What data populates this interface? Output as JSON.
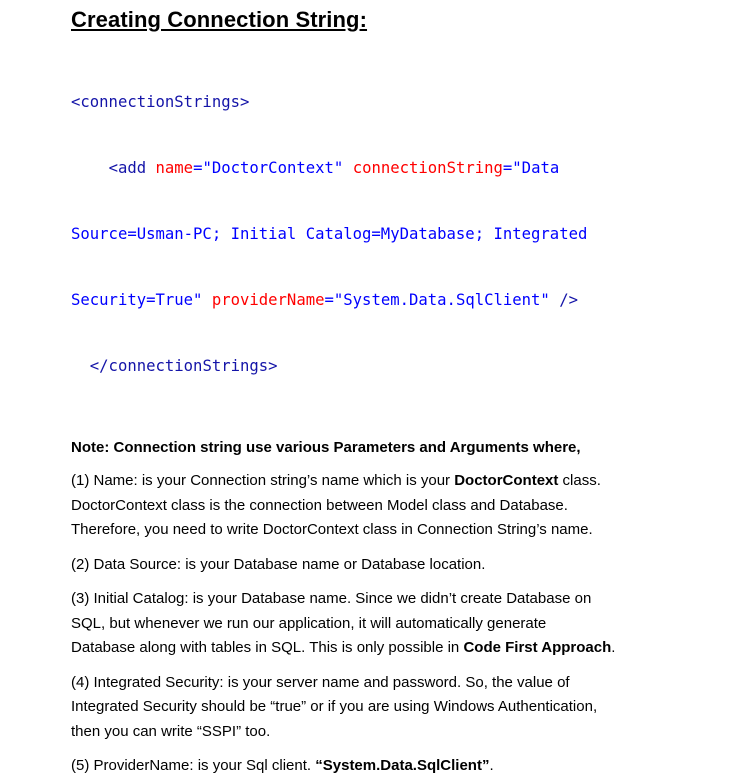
{
  "heading": "Creating Connection String:",
  "code": {
    "open_tag": "<connectionStrings>",
    "add_open": "<add ",
    "name_attr": "name",
    "eq1": "=",
    "name_value": "\"DoctorContext\"",
    "cs_attr": "connectionString",
    "eq2": "=",
    "cs_value_part1": "\"Data",
    "cs_value_part2": "Source=Usman-PC; Initial Catalog=MyDatabase; Integrated",
    "cs_value_part3": "Security=True\"",
    "provider_attr": "providerName",
    "eq3": "=",
    "provider_value": "\"System.Data.SqlClient\"",
    "add_close": " />",
    "close_tag": "</connectionStrings>"
  },
  "note": "Note: Connection string use various Parameters and Arguments where,",
  "para1": {
    "l1_a": "(1) Name: is your Connection string’s name which is your ",
    "l1_b": "DoctorContext",
    "l1_c": " class.",
    "l2": "DoctorContext class is the connection between Model class and Database.",
    "l3": "Therefore, you need to write DoctorContext class in Connection String’s name."
  },
  "para2": {
    "l1": "(2) Data Source: is your Database name or Database location."
  },
  "para3": {
    "l1": "(3) Initial Catalog: is your Database name. Since we didn’t create Database on",
    "l2": "SQL, but whenever we run our application, it will automatically generate",
    "l3_a": "Database along with tables in SQL. This is only possible in ",
    "l3_b": "Code First Approach",
    "l3_c": "."
  },
  "para4": {
    "l1": "(4) Integrated Security: is your server name and password. So, the value of",
    "l2": "Integrated Security should be “true” or if you are using Windows Authentication,",
    "l3": "then you can write “SSPI” too."
  },
  "para5": {
    "l1_a": "(5) ProviderName: is your Sql client.  ",
    "l1_b": "“System.Data.SqlClient”",
    "l1_c": "."
  },
  "colors": {
    "tag": "#1414a8",
    "attribute": "#ff0000",
    "value": "#0000ff",
    "text": "#000000"
  }
}
